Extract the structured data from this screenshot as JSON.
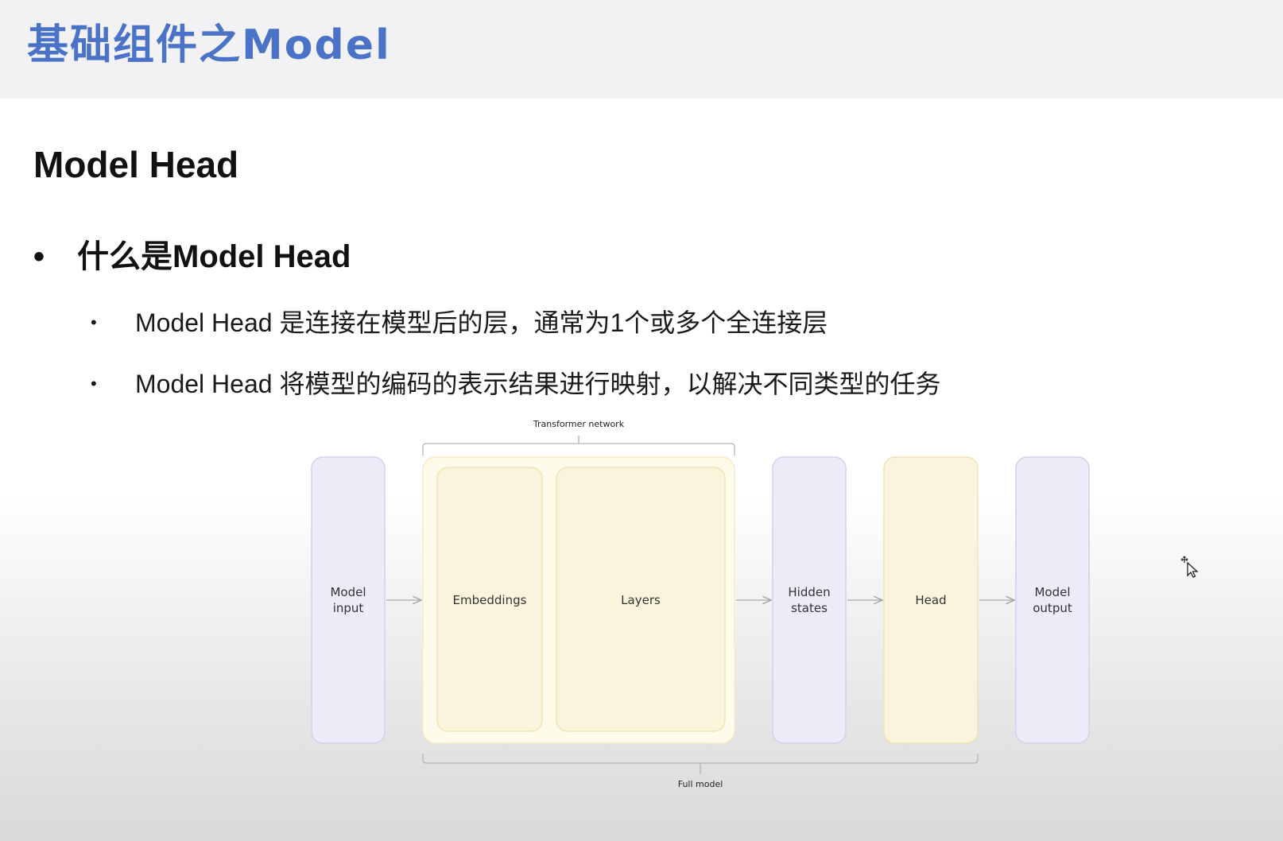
{
  "slide": {
    "title": "基础组件之Model"
  },
  "content": {
    "section_heading": "Model Head",
    "bullet_l1": "什么是Model Head",
    "bullets_l2": [
      "Model Head 是连接在模型后的层，通常为1个或多个全连接层",
      "Model Head 将模型的编码的表示结果进行映射，以解决不同类型的任务"
    ]
  },
  "diagram": {
    "top_bracket_label": "Transformer network",
    "bottom_bracket_label": "Full model",
    "blocks": {
      "model_input": "Model\ninput",
      "embeddings": "Embeddings",
      "layers": "Layers",
      "hidden_states": "Hidden\nstates",
      "head": "Head",
      "model_output": "Model\noutput"
    },
    "colors": {
      "io_box_fill": "#ecebf8",
      "io_box_stroke": "#d3d1ea",
      "core_box_fill": "#fbf4dc",
      "core_box_stroke": "#efe3b6",
      "container_fill": "#fffbea",
      "arrow": "#a8a8a8"
    }
  },
  "icons": {
    "cursor": "move-cursor-icon"
  }
}
